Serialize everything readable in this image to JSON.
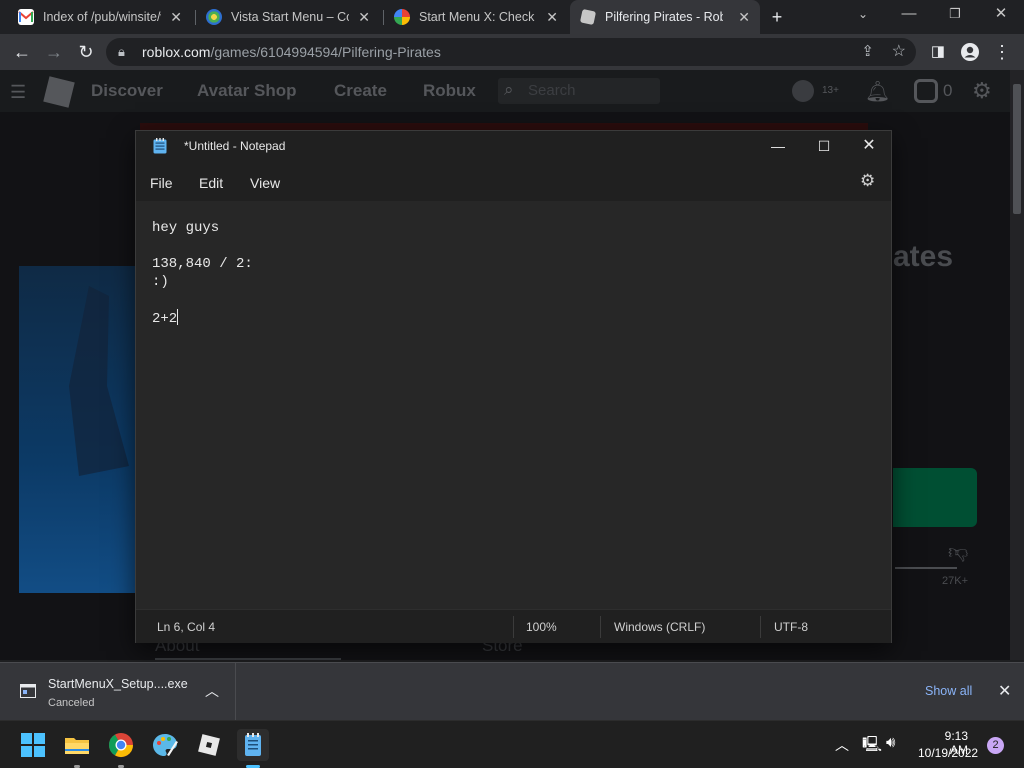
{
  "browser": {
    "tabs": [
      {
        "title": "Index of /pub/winsite/w",
        "favicon": "gmail-icon",
        "active": false
      },
      {
        "title": "Vista Start Menu – Con",
        "favicon": "vista-start-icon",
        "active": false
      },
      {
        "title": "Start Menu X: Check up",
        "favicon": "startmenux-icon",
        "active": false
      },
      {
        "title": "Pilfering Pirates - Roblo",
        "favicon": "roblox-icon",
        "active": true
      }
    ],
    "url_host": "roblox.com",
    "url_path": "/games/6104994594/Pilfering-Pirates"
  },
  "roblox": {
    "nav": [
      "Discover",
      "Avatar Shop",
      "Create",
      "Robux"
    ],
    "search_placeholder": "Search",
    "age_badge": "13+",
    "robux_count": "0",
    "game_title_fragment": "ates",
    "dislikes": "27K+",
    "section_tabs": [
      "About",
      "Store"
    ]
  },
  "notepad": {
    "title": "*Untitled - Notepad",
    "menu": [
      "File",
      "Edit",
      "View"
    ],
    "lines": [
      "hey guys",
      "",
      "138,840 / 2:",
      ":)",
      "",
      "2+2"
    ],
    "status": {
      "position": "Ln 6, Col 4",
      "zoom": "100%",
      "line_ending": "Windows (CRLF)",
      "encoding": "UTF-8"
    }
  },
  "downloads": {
    "file_name": "StartMenuX_Setup....exe",
    "status": "Canceled",
    "show_all": "Show all"
  },
  "taskbar": {
    "apps": [
      "windows-start-icon",
      "file-explorer-icon",
      "chrome-icon",
      "paint-icon",
      "roblox-icon",
      "notepad-icon"
    ],
    "time": "9:13 AM",
    "date": "10/19/2022",
    "notifications": "2"
  },
  "colors": {
    "chrome_frame": "#202124",
    "chrome_toolbar": "#35363a",
    "notepad_bg": "#272727",
    "link_blue": "#8ab4f8",
    "roblox_green": "#00b06f"
  }
}
